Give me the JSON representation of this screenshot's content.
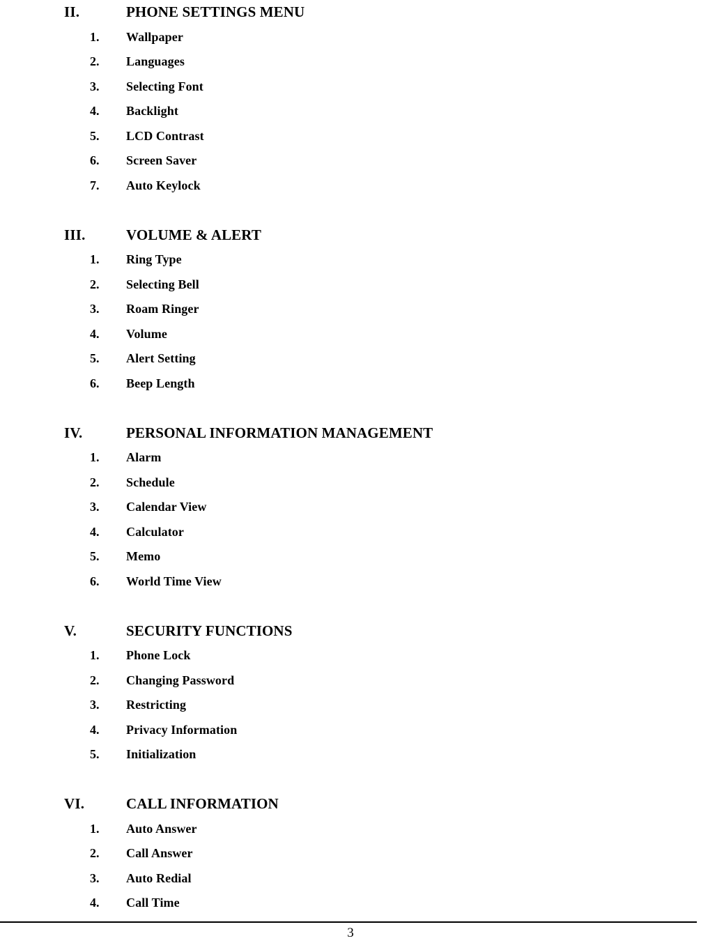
{
  "document": {
    "type": "table-of-contents",
    "page_number": "3"
  },
  "sections": [
    {
      "numeral": "II.",
      "title": "PHONE SETTINGS MENU",
      "items": [
        {
          "number": "1.",
          "label": "Wallpaper"
        },
        {
          "number": "2.",
          "label": "Languages"
        },
        {
          "number": "3.",
          "label": "Selecting Font"
        },
        {
          "number": "4.",
          "label": "Backlight"
        },
        {
          "number": "5.",
          "label": "LCD Contrast"
        },
        {
          "number": "6.",
          "label": "Screen Saver"
        },
        {
          "number": "7.",
          "label": "Auto Keylock"
        }
      ]
    },
    {
      "numeral": "III.",
      "title": "VOLUME & ALERT",
      "items": [
        {
          "number": "1.",
          "label": "Ring Type"
        },
        {
          "number": "2.",
          "label": "Selecting Bell"
        },
        {
          "number": "3.",
          "label": "Roam Ringer"
        },
        {
          "number": "4.",
          "label": "Volume"
        },
        {
          "number": "5.",
          "label": "Alert Setting"
        },
        {
          "number": "6.",
          "label": "Beep Length"
        }
      ]
    },
    {
      "numeral": "IV.",
      "title": "PERSONAL INFORMATION MANAGEMENT",
      "items": [
        {
          "number": "1.",
          "label": "Alarm"
        },
        {
          "number": "2.",
          "label": "Schedule"
        },
        {
          "number": "3.",
          "label": "Calendar View"
        },
        {
          "number": "4.",
          "label": "Calculator"
        },
        {
          "number": "5.",
          "label": "Memo"
        },
        {
          "number": "6.",
          "label": "World Time View"
        }
      ]
    },
    {
      "numeral": "V.",
      "title": "SECURITY FUNCTIONS",
      "items": [
        {
          "number": "1.",
          "label": "Phone Lock"
        },
        {
          "number": "2.",
          "label": "Changing Password"
        },
        {
          "number": "3.",
          "label": "Restricting"
        },
        {
          "number": "4.",
          "label": "Privacy Information"
        },
        {
          "number": "5.",
          "label": "Initialization"
        }
      ]
    },
    {
      "numeral": "VI.",
      "title": "CALL INFORMATION",
      "items": [
        {
          "number": "1.",
          "label": "Auto Answer"
        },
        {
          "number": "2.",
          "label": "Call Answer"
        },
        {
          "number": "3.",
          "label": "Auto Redial"
        },
        {
          "number": "4.",
          "label": "Call Time"
        }
      ]
    }
  ]
}
